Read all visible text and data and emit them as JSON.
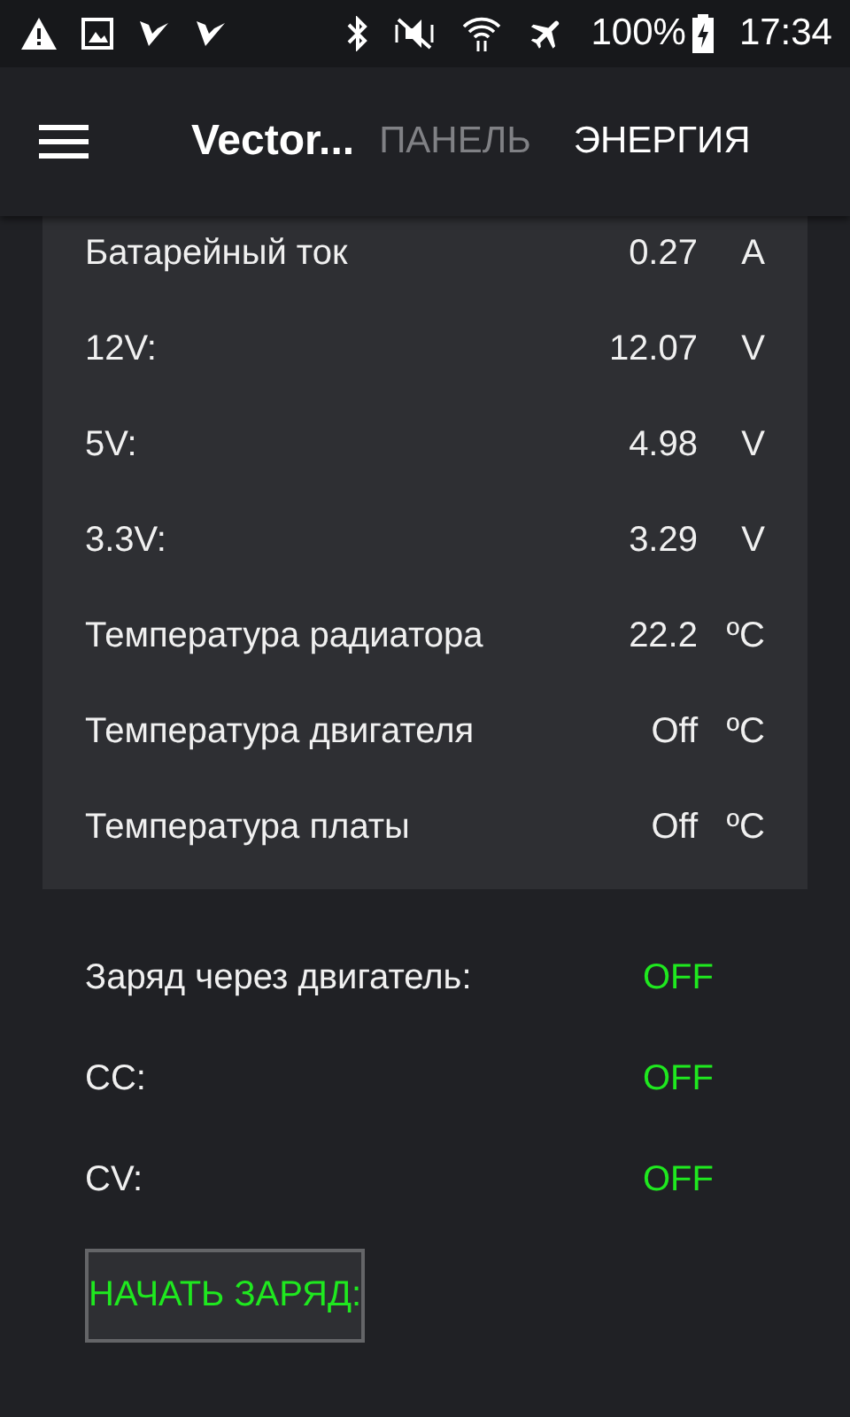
{
  "status_bar": {
    "battery": "100%",
    "time": "17:34"
  },
  "app_bar": {
    "title": "Vector...",
    "tabs": [
      {
        "label": "ПАНЕЛЬ",
        "selected": false
      },
      {
        "label": "ЭНЕРГИЯ",
        "selected": true
      }
    ]
  },
  "readings": [
    {
      "label": "Батарейный ток",
      "value": "0.27",
      "unit": "A"
    },
    {
      "label": "12V:",
      "value": "12.07",
      "unit": "V"
    },
    {
      "label": "5V:",
      "value": "4.98",
      "unit": "V"
    },
    {
      "label": "3.3V:",
      "value": "3.29",
      "unit": "V"
    },
    {
      "label": "Температура радиатора",
      "value": "22.2",
      "unit": "ºC"
    },
    {
      "label": "Температура двигателя",
      "value": "Off",
      "unit": "ºC"
    },
    {
      "label": "Температура платы",
      "value": "Off",
      "unit": "ºC"
    }
  ],
  "charge_states": [
    {
      "label": "Заряд через двигатель:",
      "value": "OFF",
      "on": false
    },
    {
      "label": "CC:",
      "value": "OFF",
      "on": false
    },
    {
      "label": "CV:",
      "value": "OFF",
      "on": false
    }
  ],
  "start_button": "НАЧАТЬ ЗАРЯД:"
}
